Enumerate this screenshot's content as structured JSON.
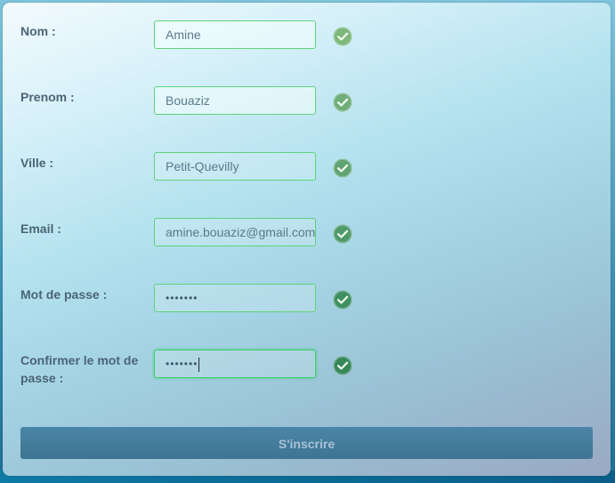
{
  "form": {
    "fields": [
      {
        "label": "Nom :",
        "value": "Amine"
      },
      {
        "label": "Prenom :",
        "value": "Bouaziz"
      },
      {
        "label": "Ville :",
        "value": "Petit-Quevilly"
      },
      {
        "label": "Email :",
        "value": "amine.bouaziz@gmail.com"
      },
      {
        "label": "Mot de passe :",
        "value": "•••••••"
      },
      {
        "label": "Confirmer le mot de passe :",
        "value": "•••••••"
      }
    ],
    "submit_label": "S'inscrire"
  },
  "icons": {
    "valid": "check-circle-icon"
  },
  "colors": {
    "valid_green": "#3cbf66",
    "button_bg": "#447d9d",
    "label": "#4b6476"
  }
}
